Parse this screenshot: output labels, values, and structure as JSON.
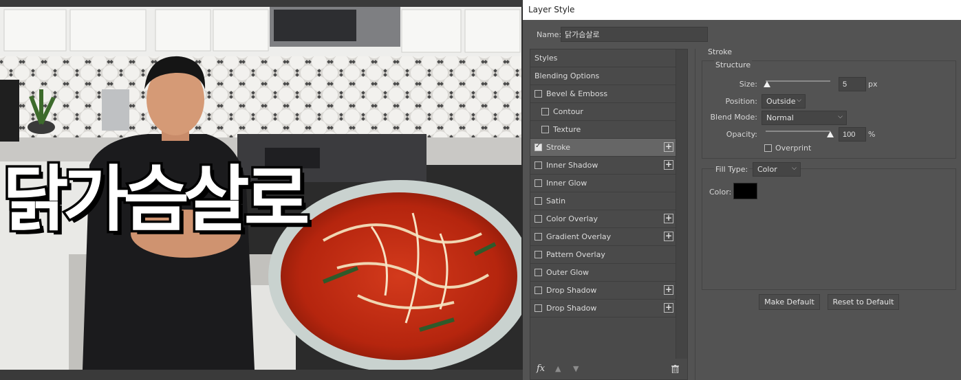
{
  "thumbnail": {
    "title_text": "닭가슴살로"
  },
  "dialog": {
    "title": "Layer Style",
    "name_label": "Name:",
    "name_value": "닭가슴살로"
  },
  "styles_list": {
    "items": [
      {
        "label": "Styles",
        "checkbox": false,
        "checked": false,
        "plus": false,
        "selected": false,
        "indent": false
      },
      {
        "label": "Blending Options",
        "checkbox": false,
        "checked": false,
        "plus": false,
        "selected": false,
        "indent": false
      },
      {
        "label": "Bevel & Emboss",
        "checkbox": true,
        "checked": false,
        "plus": false,
        "selected": false,
        "indent": false
      },
      {
        "label": "Contour",
        "checkbox": true,
        "checked": false,
        "plus": false,
        "selected": false,
        "indent": true
      },
      {
        "label": "Texture",
        "checkbox": true,
        "checked": false,
        "plus": false,
        "selected": false,
        "indent": true
      },
      {
        "label": "Stroke",
        "checkbox": true,
        "checked": true,
        "plus": true,
        "selected": true,
        "indent": false
      },
      {
        "label": "Inner Shadow",
        "checkbox": true,
        "checked": false,
        "plus": true,
        "selected": false,
        "indent": false
      },
      {
        "label": "Inner Glow",
        "checkbox": true,
        "checked": false,
        "plus": false,
        "selected": false,
        "indent": false
      },
      {
        "label": "Satin",
        "checkbox": true,
        "checked": false,
        "plus": false,
        "selected": false,
        "indent": false
      },
      {
        "label": "Color Overlay",
        "checkbox": true,
        "checked": false,
        "plus": true,
        "selected": false,
        "indent": false
      },
      {
        "label": "Gradient Overlay",
        "checkbox": true,
        "checked": false,
        "plus": true,
        "selected": false,
        "indent": false
      },
      {
        "label": "Pattern Overlay",
        "checkbox": true,
        "checked": false,
        "plus": false,
        "selected": false,
        "indent": false
      },
      {
        "label": "Outer Glow",
        "checkbox": true,
        "checked": false,
        "plus": false,
        "selected": false,
        "indent": false
      },
      {
        "label": "Drop Shadow",
        "checkbox": true,
        "checked": false,
        "plus": true,
        "selected": false,
        "indent": false
      },
      {
        "label": "Drop Shadow",
        "checkbox": true,
        "checked": false,
        "plus": true,
        "selected": false,
        "indent": false
      }
    ],
    "footer_icons": [
      "fx-icon",
      "move-up-icon",
      "move-down-icon",
      "trash-icon"
    ],
    "fx_label": "fx"
  },
  "stroke": {
    "section_title": "Stroke",
    "structure_title": "Structure",
    "size_label": "Size:",
    "size_value": "5",
    "size_unit": "px",
    "size_slider_fraction": 0.02,
    "position_label": "Position:",
    "position_value": "Outside",
    "blend_mode_label": "Blend Mode:",
    "blend_mode_value": "Normal",
    "opacity_label": "Opacity:",
    "opacity_value": "100",
    "opacity_unit": "%",
    "opacity_slider_fraction": 1.0,
    "overprint_label": "Overprint",
    "overprint_checked": false,
    "fill_type_label": "Fill Type:",
    "fill_type_value": "Color",
    "color_label": "Color:",
    "color_hex": "#000000"
  },
  "buttons": {
    "make_default": "Make Default",
    "reset_to_default": "Reset to Default"
  },
  "colors": {
    "dialog_bg": "#535353",
    "selected_row": "#666666",
    "input_bg": "#454545"
  }
}
